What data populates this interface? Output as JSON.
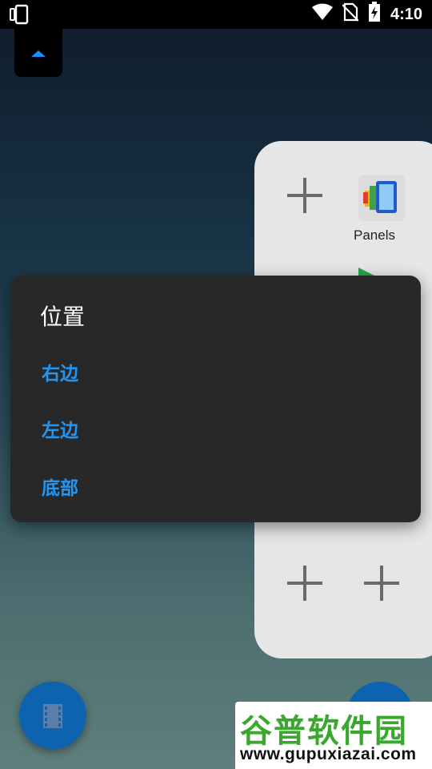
{
  "status_bar": {
    "left_icon": "device-rotate-icon",
    "icons": [
      "wifi-icon",
      "no-sim-icon",
      "battery-charging-icon"
    ],
    "time": "4:10"
  },
  "scroll_tab": {
    "icon": "arrow-up-icon",
    "accent": "#1e90ff"
  },
  "panel": {
    "app_label": "Panels",
    "buttons": [
      "add-icon",
      "add-icon",
      "add-icon"
    ]
  },
  "dialog": {
    "title": "位置",
    "options": [
      "右边",
      "左边",
      "底部"
    ],
    "accent": "#2196f3"
  },
  "fab": {
    "icon": "film-icon",
    "color": "#0d63b0"
  },
  "watermark": {
    "title": "谷普软件园",
    "url": "www.gupuxiazai.com"
  }
}
